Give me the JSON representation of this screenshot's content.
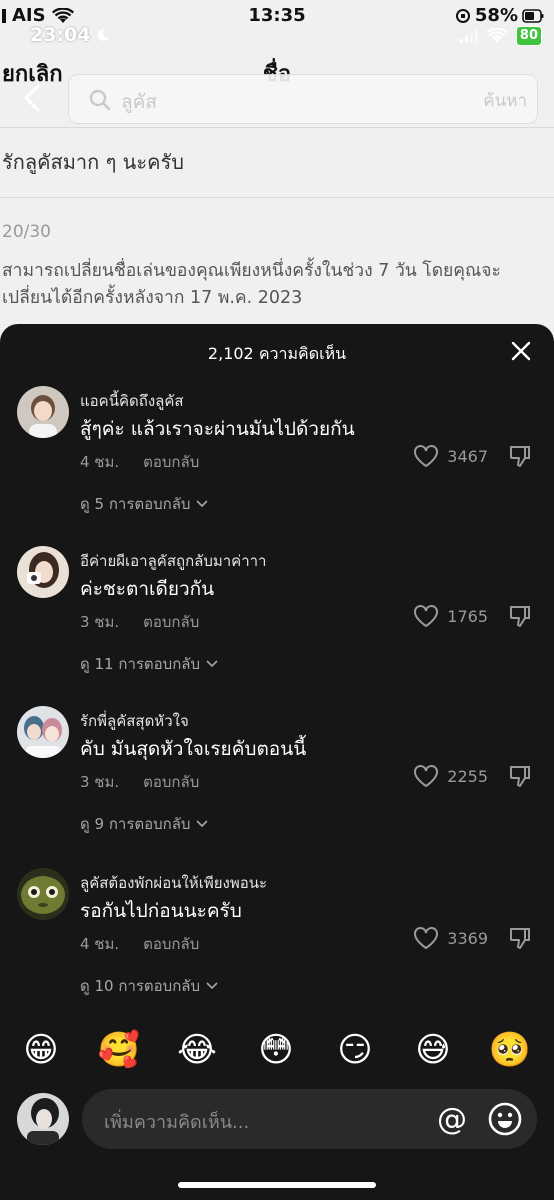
{
  "outer_status": {
    "carrier": "AIS",
    "time": "13:35",
    "battery": "58%"
  },
  "inner_status": {
    "time": "23:04",
    "battery": "80"
  },
  "nav": {
    "cancel": "ยกเลิก",
    "title": "ชื่อ"
  },
  "search": {
    "query": "ลูคัส",
    "action": "ค้นหา"
  },
  "profile": {
    "bio": "รักลูคัสมาก ๆ นะครับ",
    "counter": "20/30",
    "hint": "สามารถเปลี่ยนชื่อเล่นของคุณเพียงหนึ่งครั้งในช่วง 7 วัน โดยคุณจะเปลี่ยนได้อีกครั้งหลังจาก 17 พ.ค. 2023"
  },
  "sheet": {
    "count_label": "2,102 ความคิดเห็น"
  },
  "comments": [
    {
      "user": "แอคนี้คิดถึงลูคัส",
      "text": "สู้ๆค่ะ แล้วเราจะผ่านมันไปด้วยกัน",
      "time": "4 ชม.",
      "reply": "ตอบกลับ",
      "likes": "3467",
      "replies": "ดู 5 การตอบกลับ"
    },
    {
      "user": "อีค่ายผีเอาลูคัสถูกลับมาค่าาา",
      "text": "ค่ะชะตาเดียวกัน",
      "time": "3 ชม.",
      "reply": "ตอบกลับ",
      "likes": "1765",
      "replies": "ดู 11 การตอบกลับ"
    },
    {
      "user": "รักพี่ลูคัสสุดหัวใจ",
      "text": "คับ มันสุดหัวใจเรยคับตอนนี้",
      "time": "3 ชม.",
      "reply": "ตอบกลับ",
      "likes": "2255",
      "replies": "ดู 9 การตอบกลับ"
    },
    {
      "user": "ลูคัสต้องพักผ่อนให้เพียงพอนะ",
      "text": "รอกันไปก่อนนะครับ",
      "time": "4 ชม.",
      "reply": "ตอบกลับ",
      "likes": "3369",
      "replies": "ดู 10 การตอบกลับ"
    }
  ],
  "emojis": [
    "😁",
    "🥰",
    "😂",
    "😳",
    "😏",
    "😅",
    "🥺"
  ],
  "composer": {
    "placeholder": "เพิ่มความคิดเห็น...",
    "mention": "@"
  },
  "colors": {
    "sheet_bg": "#161616",
    "muted": "#9a9a9a",
    "battery_green": "#3ec43e"
  }
}
